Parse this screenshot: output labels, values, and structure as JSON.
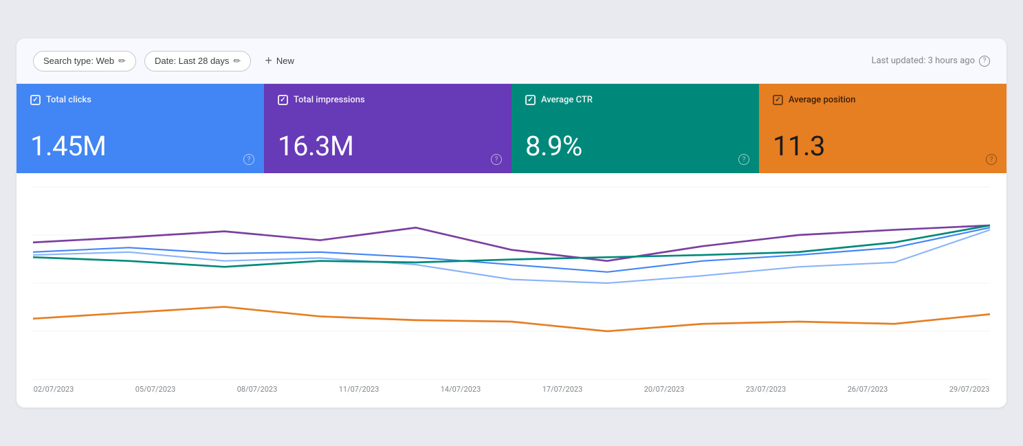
{
  "toolbar": {
    "search_type_label": "Search type: Web",
    "date_label": "Date: Last 28 days",
    "new_label": "New",
    "last_updated": "Last updated: 3 hours ago"
  },
  "metrics": [
    {
      "id": "clicks",
      "label": "Total clicks",
      "value": "1.45M",
      "checked": true,
      "color_class": "clicks"
    },
    {
      "id": "impressions",
      "label": "Total impressions",
      "value": "16.3M",
      "checked": true,
      "color_class": "impressions"
    },
    {
      "id": "ctr",
      "label": "Average CTR",
      "value": "8.9%",
      "checked": true,
      "color_class": "ctr"
    },
    {
      "id": "position",
      "label": "Average position",
      "value": "11.3",
      "checked": true,
      "color_class": "position"
    }
  ],
  "chart": {
    "x_labels": [
      "02/07/2023",
      "05/07/2023",
      "08/07/2023",
      "11/07/2023",
      "14/07/2023",
      "17/07/2023",
      "20/07/2023",
      "23/07/2023",
      "26/07/2023",
      "29/07/2023"
    ]
  }
}
